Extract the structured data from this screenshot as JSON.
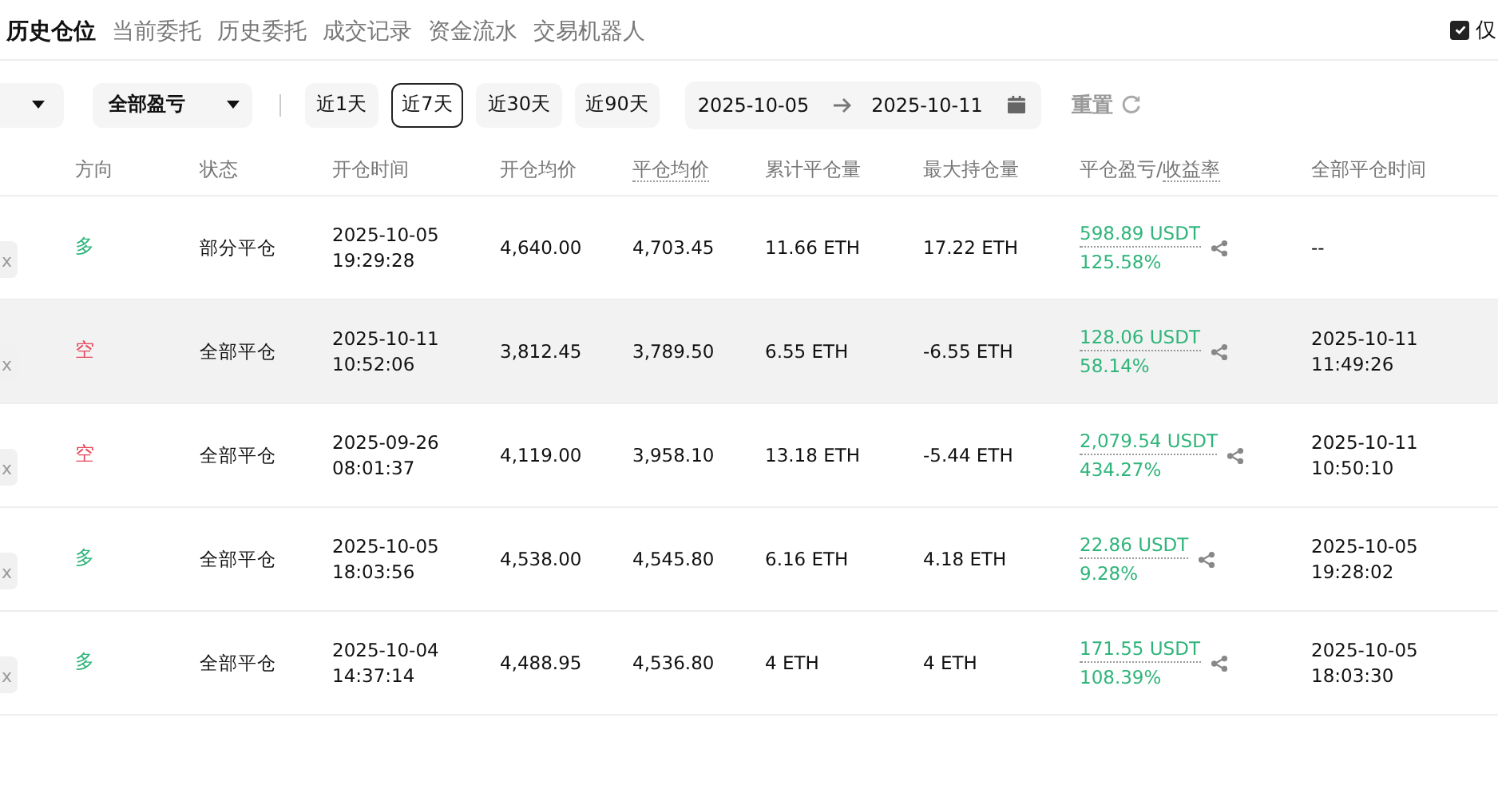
{
  "tabs": [
    {
      "label": "历史仓位",
      "selected": true
    },
    {
      "label": "当前委托",
      "selected": false
    },
    {
      "label": "历史委托",
      "selected": false
    },
    {
      "label": "成交记录",
      "selected": false
    },
    {
      "label": "资金流水",
      "selected": false
    },
    {
      "label": "交易机器人",
      "selected": false
    }
  ],
  "only_filter": {
    "label": "仅",
    "checked": true
  },
  "filters": {
    "pnl_dropdown": "全部盈亏",
    "periods": [
      {
        "label": "近1天",
        "selected": false
      },
      {
        "label": "近7天",
        "selected": true
      },
      {
        "label": "近30天",
        "selected": false
      },
      {
        "label": "近90天",
        "selected": false
      }
    ],
    "date_start": "2025-10-05",
    "date_end": "2025-10-11",
    "reset": "重置"
  },
  "table": {
    "columns": [
      {
        "label": "方向",
        "dotted": false
      },
      {
        "label": "状态",
        "dotted": false
      },
      {
        "label": "开仓时间",
        "dotted": false
      },
      {
        "label": "开仓均价",
        "dotted": false
      },
      {
        "label": "平仓均价",
        "dotted": true
      },
      {
        "label": "累计平仓量",
        "dotted": false
      },
      {
        "label": "最大持仓量",
        "dotted": false
      },
      {
        "label": "平仓盈亏/",
        "dotted": false,
        "suffix": "收益率"
      },
      {
        "label": "全部平仓时间",
        "dotted": false
      }
    ],
    "rows": [
      {
        "leverage": "x",
        "side": "多",
        "color": "#2fb57a",
        "highlighted": false,
        "status": "部分平仓",
        "open_date": "2025-10-05",
        "open_time": "19:29:28",
        "open_avg": "4,640.00",
        "close_avg": "4,703.45",
        "closed_qty": "11.66 ETH",
        "max_qty": "17.22 ETH",
        "pnl": "598.89 USDT",
        "roi": "125.58%",
        "close_date": "--"
      },
      {
        "leverage": "x",
        "side": "空",
        "color": "#e5475a",
        "highlighted": true,
        "status": "全部平仓",
        "open_date": "2025-10-11",
        "open_time": "10:52:06",
        "open_avg": "3,812.45",
        "close_avg": "3,789.50",
        "closed_qty": "6.55 ETH",
        "max_qty": "-6.55 ETH",
        "pnl": "128.06 USDT",
        "roi": "58.14%",
        "close_date": "2025-10-11",
        "close_time": "11:49:26"
      },
      {
        "leverage": "x",
        "side": "空",
        "color": "#e5475a",
        "highlighted": false,
        "status": "全部平仓",
        "open_date": "2025-09-26",
        "open_time": "08:01:37",
        "open_avg": "4,119.00",
        "close_avg": "3,958.10",
        "closed_qty": "13.18 ETH",
        "max_qty": "-5.44 ETH",
        "pnl": "2,079.54 USDT",
        "roi": "434.27%",
        "close_date": "2025-10-11",
        "close_time": "10:50:10"
      },
      {
        "leverage": "x",
        "side": "多",
        "color": "#2fb57a",
        "highlighted": false,
        "status": "全部平仓",
        "open_date": "2025-10-05",
        "open_time": "18:03:56",
        "open_avg": "4,538.00",
        "close_avg": "4,545.80",
        "closed_qty": "6.16 ETH",
        "max_qty": "4.18 ETH",
        "pnl": "22.86 USDT",
        "roi": "9.28%",
        "close_date": "2025-10-05",
        "close_time": "19:28:02"
      },
      {
        "leverage": "x",
        "side": "多",
        "color": "#2fb57a",
        "highlighted": false,
        "status": "全部平仓",
        "open_date": "2025-10-04",
        "open_time": "14:37:14",
        "open_avg": "4,488.95",
        "close_avg": "4,536.80",
        "closed_qty": "4 ETH",
        "max_qty": "4 ETH",
        "pnl": "171.55 USDT",
        "roi": "108.39%",
        "close_date": "2025-10-05",
        "close_time": "18:03:30"
      }
    ]
  }
}
